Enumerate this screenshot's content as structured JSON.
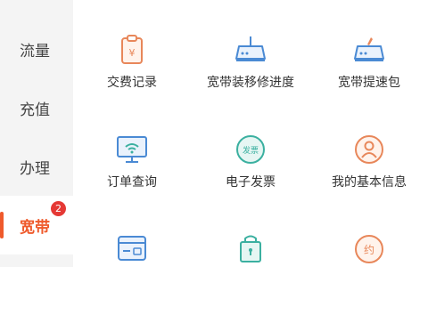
{
  "sidebar": {
    "items": [
      {
        "label": "流量"
      },
      {
        "label": "充值"
      },
      {
        "label": "办理"
      },
      {
        "label": "宽带",
        "badge": "2",
        "active": true
      }
    ]
  },
  "grid": {
    "items": [
      {
        "label": "交费记录",
        "icon": "bill-clipboard-icon"
      },
      {
        "label": "宽带装移修进度",
        "icon": "router-icon"
      },
      {
        "label": "宽带提速包",
        "icon": "router-speed-icon"
      },
      {
        "label": "订单查询",
        "icon": "monitor-wifi-icon"
      },
      {
        "label": "电子发票",
        "icon": "e-invoice-icon"
      },
      {
        "label": "我的基本信息",
        "icon": "user-profile-icon"
      },
      {
        "label": "",
        "icon": "card-lock-icon"
      },
      {
        "label": "",
        "icon": "lock-screen-icon"
      },
      {
        "label": "",
        "icon": "appointment-icon"
      }
    ],
    "icon_texts": {
      "invoice": "发票",
      "appointment": "约"
    }
  },
  "colors": {
    "accent": "#ef5a2c",
    "icon_orange": "#e8875a",
    "icon_blue": "#4a8ad4",
    "icon_teal": "#3bb0a0",
    "badge": "#e53935"
  }
}
